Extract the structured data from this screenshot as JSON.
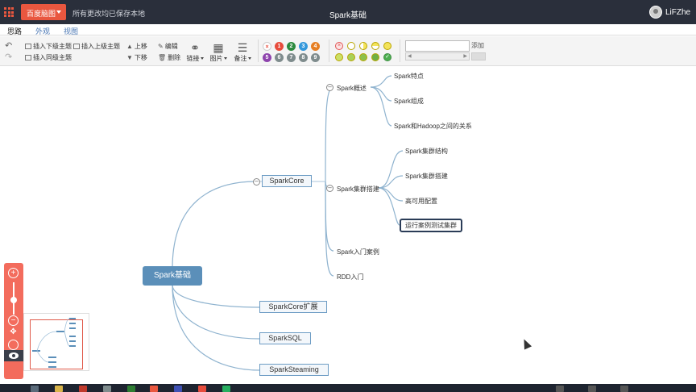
{
  "header": {
    "brand_label": "百度脑图",
    "save_status": "所有更改均已保存本地",
    "doc_title": "Spark基础",
    "user_name": "LiFZhe"
  },
  "tabs": [
    {
      "label": "思路",
      "active": true
    },
    {
      "label": "外观",
      "active": false
    },
    {
      "label": "视图",
      "active": false
    }
  ],
  "toolbar": {
    "insert_child": "插入下级主题",
    "insert_parent": "插入上级主题",
    "insert_sibling": "插入同级主题",
    "move_up": "上移",
    "move_down": "下移",
    "edit": "编辑",
    "delete": "删除",
    "link": "链接",
    "image": "图片",
    "note": "备注",
    "priorities": [
      "1",
      "2",
      "3",
      "4",
      "5",
      "6",
      "7",
      "8",
      "9"
    ],
    "priority_colors": [
      "#e74c3c",
      "#e67e22",
      "#3498db",
      "#2c8a3e",
      "#8e44ad",
      "#7f8c8d",
      "#7f8c8d",
      "#7f8c8d",
      "#7f8c8d"
    ],
    "tag_add": "添加"
  },
  "mindmap": {
    "root": "Spark基础",
    "branches": {
      "core": "SparkCore",
      "core_ext": "SparkCore扩展",
      "sql": "SparkSQL",
      "streaming": "SparkSteaming"
    },
    "core_children": {
      "overview": "Spark概述",
      "cluster": "Spark集群搭建",
      "intro_case": "Spark入门案例",
      "rdd": "RDD入门"
    },
    "overview_children": [
      "Spark特点",
      "Spark组成",
      "Spark和Hadoop之间的关系"
    ],
    "cluster_children": [
      "Spark集群结构",
      "Spark集群搭建",
      "高可用配置",
      "运行案例测试集群"
    ]
  },
  "colors": {
    "titlebar": "#2a2f3b",
    "accent": "#e9573f",
    "root_node": "#5b8fb9",
    "branch_line": "#8fb3cf"
  }
}
